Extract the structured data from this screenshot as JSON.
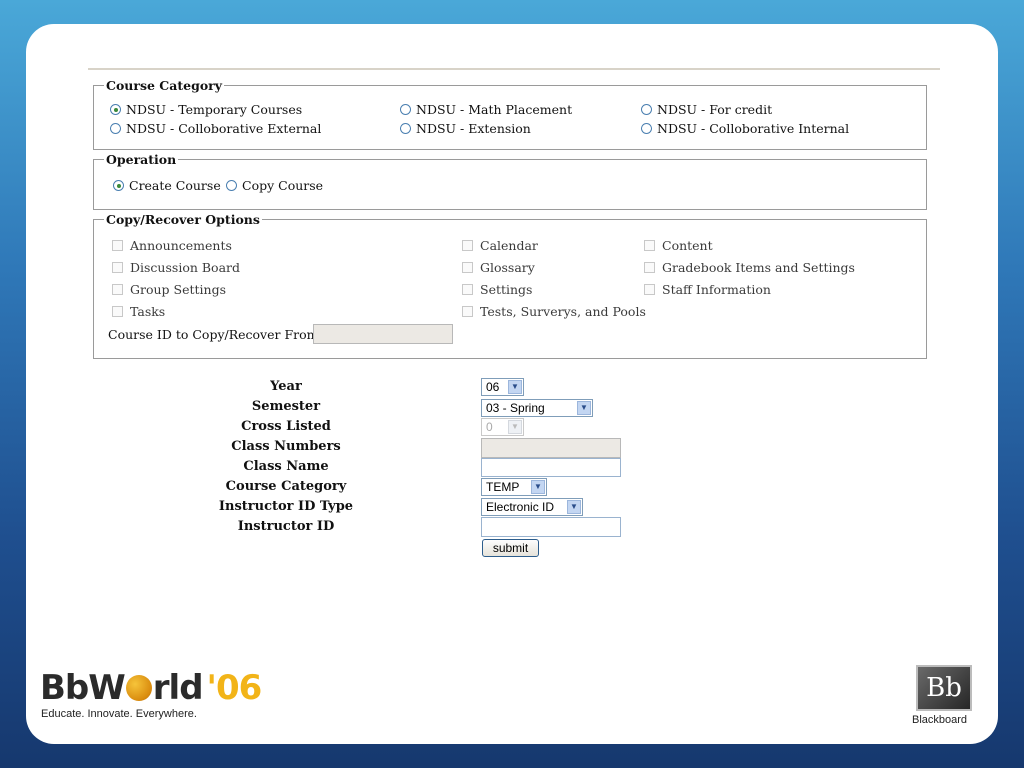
{
  "course_category": {
    "legend": "Course Category",
    "options": [
      {
        "label": "NDSU - Temporary Courses",
        "selected": true
      },
      {
        "label": "NDSU - Math Placement",
        "selected": false
      },
      {
        "label": "NDSU - For credit",
        "selected": false
      },
      {
        "label": "NDSU - Colloborative External",
        "selected": false
      },
      {
        "label": "NDSU - Extension",
        "selected": false
      },
      {
        "label": "NDSU - Colloborative Internal",
        "selected": false
      }
    ]
  },
  "operation": {
    "legend": "Operation",
    "create_label": "Create Course",
    "copy_label": "Copy Course",
    "selected": "Create Course"
  },
  "copy_options": {
    "legend": "Copy/Recover Options",
    "items": [
      "Announcements",
      "Calendar",
      "Content",
      "Discussion Board",
      "Glossary",
      "Gradebook Items and Settings",
      "Group Settings",
      "Settings",
      "Staff Information",
      "Tasks",
      "Tests, Surverys, and Pools"
    ],
    "course_id_label": "Course ID to Copy/Recover From",
    "course_id_value": ""
  },
  "form": {
    "labels": {
      "year": "Year",
      "semester": "Semester",
      "cross_listed": "Cross Listed",
      "class_numbers": "Class Numbers",
      "class_name": "Class Name",
      "course_category": "Course Category",
      "instructor_id_type": "Instructor ID Type",
      "instructor_id": "Instructor ID"
    },
    "values": {
      "year": "06",
      "semester": "03 - Spring",
      "cross_listed": "0",
      "class_numbers": "",
      "class_name": "",
      "course_category": "TEMP",
      "instructor_id_type": "Electronic ID",
      "instructor_id": ""
    },
    "submit_label": "submit"
  },
  "branding": {
    "logo_text": "BbW",
    "logo_text_2": "rld",
    "logo_year": "'06",
    "tagline": "Educate. Innovate. Everywhere.",
    "bb_mark": "Bb",
    "bb_name": "Blackboard",
    "accent_color": "#f2b418"
  }
}
